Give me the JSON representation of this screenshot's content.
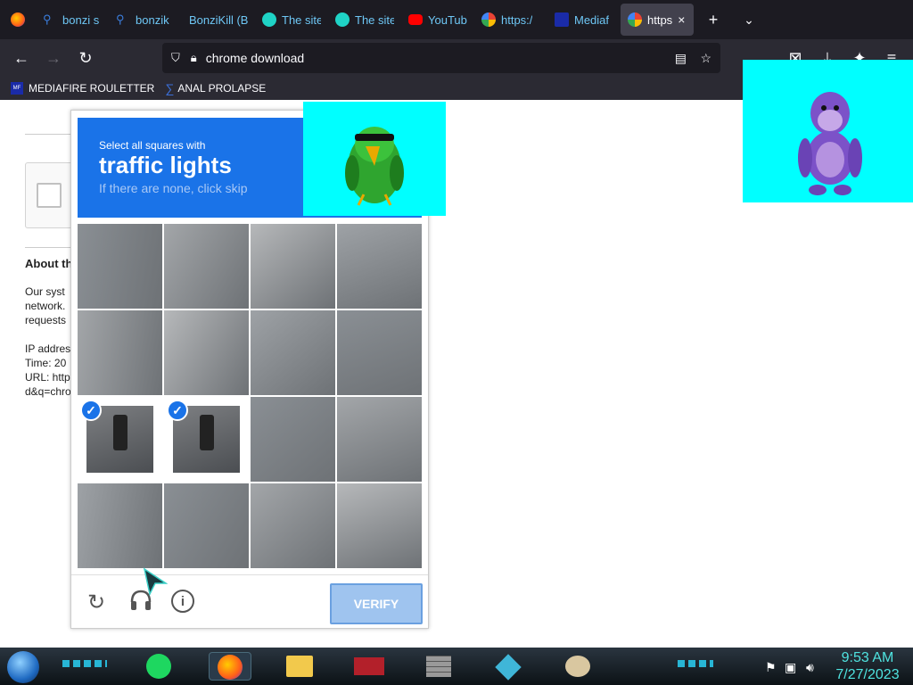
{
  "browser": {
    "tabs": [
      {
        "label": "bonzi s",
        "favicon": "search-icon",
        "color": "#3b7ddd"
      },
      {
        "label": "bonzik",
        "favicon": "search-icon",
        "color": "#3b7ddd"
      },
      {
        "label": "BonziKill (B",
        "favicon": "",
        "color": ""
      },
      {
        "label": "The site",
        "favicon": "site-icon",
        "color": "#1fd3c6"
      },
      {
        "label": "The site",
        "favicon": "site-icon",
        "color": "#1fd3c6"
      },
      {
        "label": "YouTub",
        "favicon": "youtube-icon",
        "color": "#ff0000"
      },
      {
        "label": "https:/",
        "favicon": "google-icon",
        "color": "#ffffff"
      },
      {
        "label": "Mediaf",
        "favicon": "mediafire-icon",
        "color": "#1a2ba8"
      },
      {
        "label": "https",
        "favicon": "google-icon",
        "color": "#ffffff",
        "active": true
      }
    ],
    "new_tab": "+",
    "url": "chrome download",
    "bookmarks": [
      {
        "label": "MEDIAFIRE ROULETTER",
        "icon": "mediafire-icon"
      },
      {
        "label": "ANAL PROLAPSE",
        "icon": "sigma-icon"
      }
    ]
  },
  "page": {
    "about_heading": "About th",
    "para_lines": [
      "Our syst",
      "network.",
      "requests"
    ],
    "info_lines": [
      "IP addres",
      "Time: 20",
      "URL: http",
      "d&q=chro"
    ]
  },
  "captcha": {
    "instruction": "Select all squares with",
    "target": "traffic lights",
    "hint": "If there are none, click skip",
    "verify_label": "VERIFY",
    "selected_tiles": [
      8,
      9
    ]
  },
  "taskbar": {
    "time": "9:53 AM",
    "date": "7/27/2023"
  },
  "colors": {
    "accent": "#1a73e8",
    "overlay_bg": "#00ffff",
    "bonzi": "#7c52c8",
    "parrot": "#2fa52f"
  }
}
